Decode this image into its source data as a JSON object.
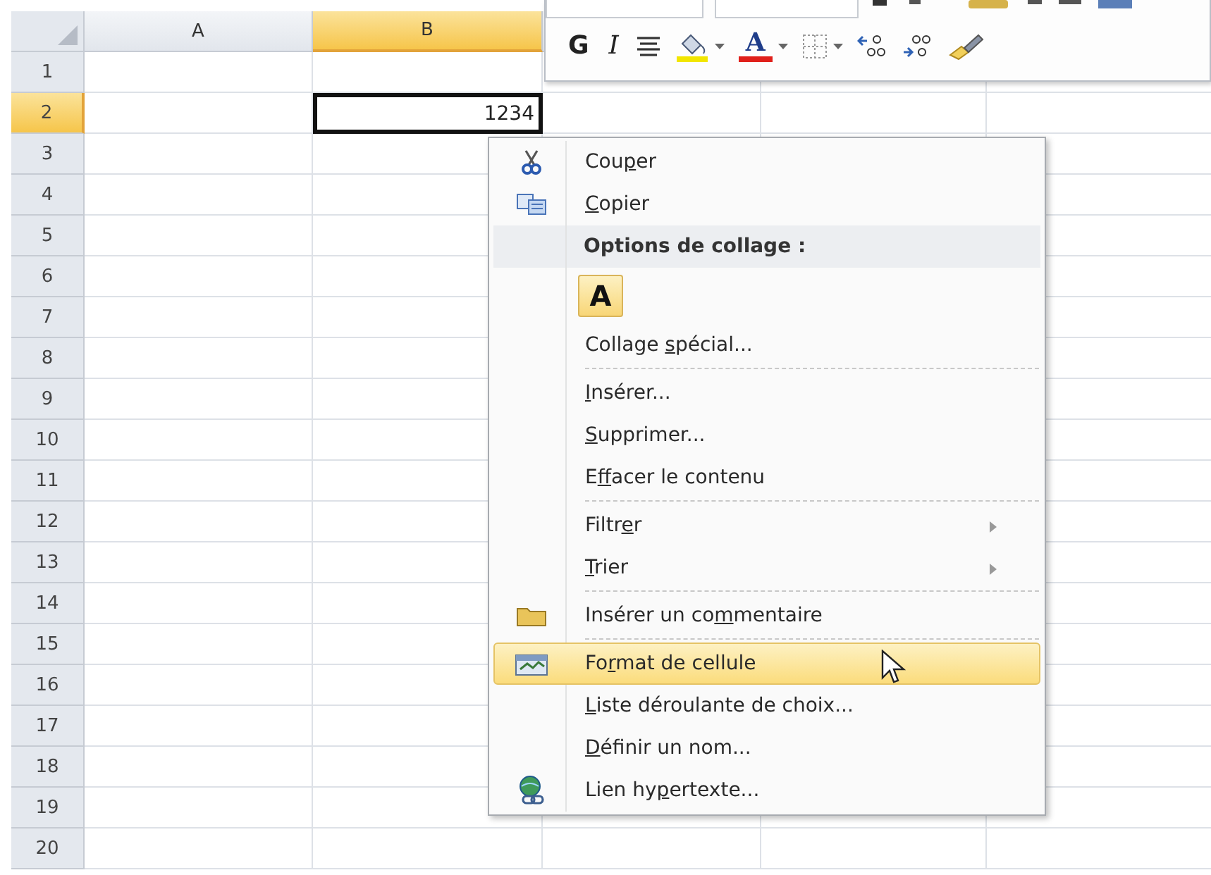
{
  "sheet": {
    "columns": [
      {
        "label": "A",
        "selected": false
      },
      {
        "label": "B",
        "selected": true
      }
    ],
    "rows": [
      {
        "label": "1",
        "selected": false
      },
      {
        "label": "2",
        "selected": true
      },
      {
        "label": "3",
        "selected": false
      },
      {
        "label": "4",
        "selected": false
      },
      {
        "label": "5",
        "selected": false
      },
      {
        "label": "6",
        "selected": false
      },
      {
        "label": "7",
        "selected": false
      },
      {
        "label": "8",
        "selected": false
      },
      {
        "label": "9",
        "selected": false
      },
      {
        "label": "10",
        "selected": false
      },
      {
        "label": "11",
        "selected": false
      },
      {
        "label": "12",
        "selected": false
      },
      {
        "label": "13",
        "selected": false
      },
      {
        "label": "14",
        "selected": false
      },
      {
        "label": "15",
        "selected": false
      },
      {
        "label": "16",
        "selected": false
      },
      {
        "label": "17",
        "selected": false
      },
      {
        "label": "18",
        "selected": false
      },
      {
        "label": "19",
        "selected": false
      },
      {
        "label": "20",
        "selected": false
      }
    ],
    "active_cell": {
      "value": "1234"
    }
  },
  "mini_toolbar": {
    "buttons": [
      {
        "kind": "bold",
        "label": "G"
      },
      {
        "kind": "italic",
        "label": "I"
      },
      {
        "kind": "align"
      },
      {
        "kind": "fill-color",
        "color": "#f2e600"
      },
      {
        "kind": "font-color",
        "label": "A",
        "color": "#e0201b"
      },
      {
        "kind": "borders"
      },
      {
        "kind": "increase-decimal"
      },
      {
        "kind": "decrease-decimal"
      },
      {
        "kind": "format-painter"
      }
    ]
  },
  "context_menu": {
    "items": [
      {
        "kind": "command",
        "label": {
          "pre": "Cou",
          "key": "p",
          "post": "er"
        },
        "selected": false,
        "submenu": false,
        "separator_after": false
      },
      {
        "kind": "command",
        "label": {
          "key": "C",
          "post": "opier"
        },
        "selected": false,
        "submenu": false,
        "separator_after": false
      },
      {
        "kind": "heading",
        "label": "Options de collage :"
      },
      {
        "kind": "paste-options",
        "options": [
          {
            "label": "A"
          }
        ]
      },
      {
        "kind": "command",
        "label": {
          "pre": "Collage ",
          "key": "s",
          "post": "pécial..."
        },
        "selected": false,
        "submenu": false,
        "separator_after": true
      },
      {
        "kind": "command",
        "label": {
          "key": "I",
          "post": "nsérer..."
        },
        "selected": false,
        "submenu": false,
        "separator_after": false
      },
      {
        "kind": "command",
        "label": {
          "key": "S",
          "post": "upprimer..."
        },
        "selected": false,
        "submenu": false,
        "separator_after": false
      },
      {
        "kind": "command",
        "label": {
          "pre": "E",
          "key": "f",
          "post": "facer le contenu"
        },
        "selected": false,
        "submenu": false,
        "separator_after": true
      },
      {
        "kind": "command",
        "label": {
          "pre": "Filtr",
          "key": "e",
          "post": "r"
        },
        "selected": false,
        "submenu": true,
        "separator_after": false
      },
      {
        "kind": "command",
        "label": {
          "key": "T",
          "post": "rier"
        },
        "selected": false,
        "submenu": true,
        "separator_after": true
      },
      {
        "kind": "command",
        "label": {
          "pre": "Insérer un co",
          "key": "m",
          "post": "mentaire"
        },
        "selected": false,
        "submenu": false,
        "separator_after": true
      },
      {
        "kind": "command",
        "label": {
          "pre": "Fo",
          "key": "r",
          "post": "mat de cellule"
        },
        "selected": true,
        "submenu": false,
        "separator_after": false
      },
      {
        "kind": "command",
        "label": {
          "key": "L",
          "post": "iste déroulante de choix..."
        },
        "selected": false,
        "submenu": false,
        "separator_after": false
      },
      {
        "kind": "command",
        "label": {
          "key": "D",
          "post": "éfinir un nom..."
        },
        "selected": false,
        "submenu": false,
        "separator_after": false
      },
      {
        "kind": "command",
        "label": {
          "pre": "Lien hy",
          "key": "p",
          "post": "ertexte..."
        },
        "selected": false,
        "submenu": false,
        "separator_after": false
      }
    ]
  }
}
